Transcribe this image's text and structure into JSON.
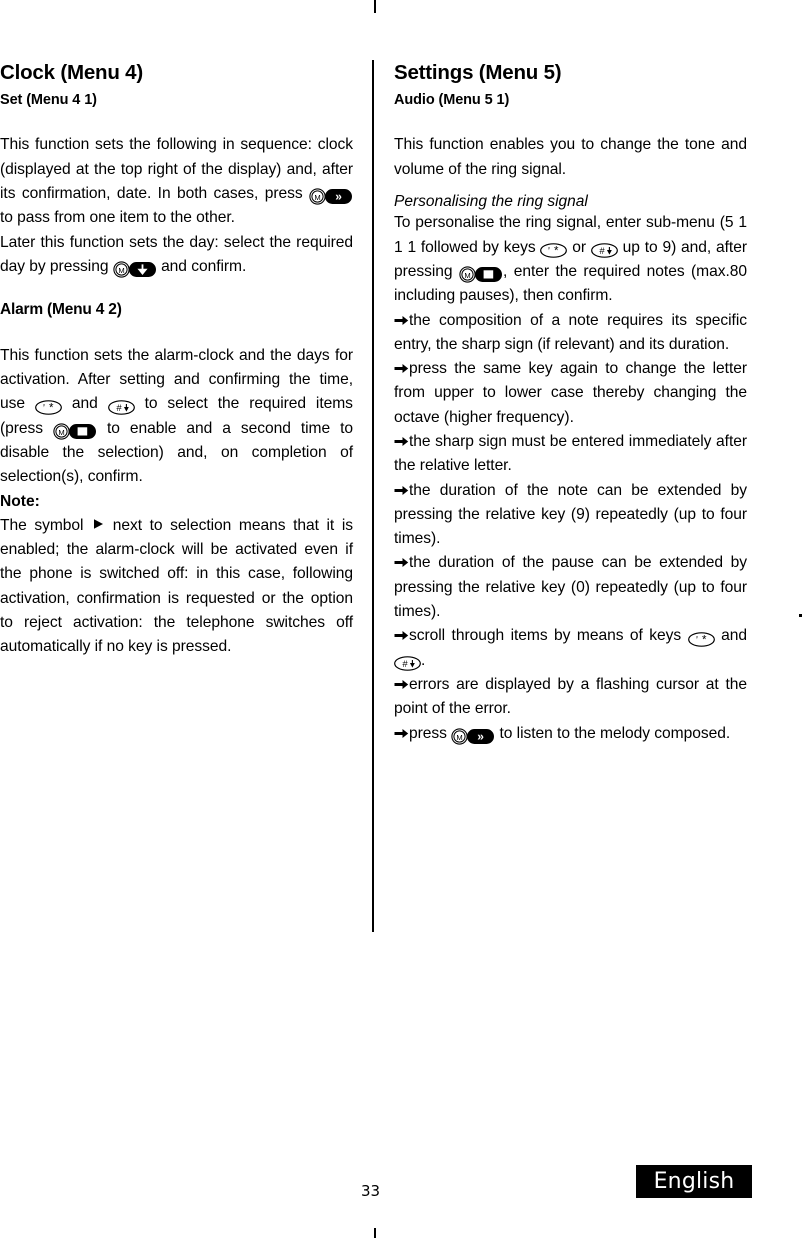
{
  "page": {
    "number": "33",
    "language_badge": "English",
    "icons": {
      "menu_key": "menu-m-key-icon",
      "right_soft_key": "double-chevron-right-key-icon",
      "down_soft_key": "down-arrow-key-icon",
      "select_soft_key": "square-select-key-icon",
      "star_key": "star-up-key-icon",
      "hash_key": "hash-down-key-icon",
      "bullet": "right-arrow-bullet-icon",
      "triangle": "right-triangle-symbol"
    }
  },
  "left_column": {
    "chapter_title": "Clock (Menu 4)",
    "section_title": "Set (Menu 4 1)",
    "paragraph_1_a": "This function sets the following in sequence: clock (displayed at the top right of the display) and, after its confirmation, date. In both cases, press",
    "paragraph_1_b": "to pass from one item to the other.",
    "paragraph_2_a": "Later this function sets the day: select the required day by pressing",
    "paragraph_2_b": "and confirm.",
    "alarm_heading": "Alarm (Menu 4 2)",
    "paragraph_3_a": "This function sets the alarm-clock and the days for activation. After setting and confirming the time, use",
    "paragraph_3_b": "and",
    "paragraph_3_c": "to select the required items (press",
    "paragraph_3_d": "to enable and a second time to disable the selection) and, on completion of selection(s), confirm.",
    "note_label": "Note:",
    "note_a": "The symbol",
    "note_b": "next to selection means that it is enabled; the alarm-clock will be activated even if the phone is switched off: in this case, following activation, confirmation is requested or the option to reject activation: the telephone switches off automatically if no key is pressed."
  },
  "right_column": {
    "chapter_title": "Settings (Menu 5)",
    "section_title": "Audio (Menu 5 1)",
    "paragraph_1": "This function enables you to change the tone and volume of the ring signal.",
    "italic_heading": "Personalising the ring signal",
    "paragraph_2_a": "To personalise the ring signal, enter sub-menu (5 1 1 1 followed by keys",
    "paragraph_2_b": "or",
    "paragraph_2_c": "up to 9) and, after pressing",
    "paragraph_2_d": ", enter the required notes (max.80 including pauses), then confirm.",
    "bullets": [
      {
        "text": "the composition of a note requires its specific entry, the sharp sign (if relevant) and its duration."
      },
      {
        "text": "press the same key again to change the letter from upper to lower case thereby changing the octave (higher frequency)."
      },
      {
        "text": "the sharp sign must be entered immediately after the relative letter."
      },
      {
        "text": "the duration of the note can be extended by pressing the relative key (9) repeatedly (up to four times)."
      },
      {
        "text": "the duration of the pause can be extended by pressing the relative key (0) repeatedly (up to four times)."
      }
    ],
    "bullet_scroll_a": "scroll through items by means of keys",
    "bullet_scroll_b": "and",
    "bullet_scroll_c": ".",
    "bullet_errors": "errors are displayed by a flashing cursor at the point of the error.",
    "bullet_listen_a": "press",
    "bullet_listen_b": "to listen to the melody composed."
  }
}
